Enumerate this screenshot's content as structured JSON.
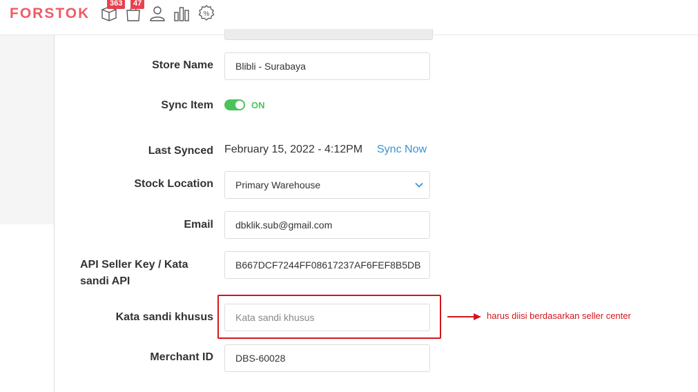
{
  "header": {
    "logo": "FORSTOK",
    "badges": {
      "packages": "363",
      "bags": "47"
    },
    "icons": [
      "package-icon",
      "bag-icon",
      "user-icon",
      "chart-bar-icon",
      "discount-icon"
    ]
  },
  "form": {
    "store_name": {
      "label": "Store Name",
      "value": "Blibli -  Surabaya"
    },
    "sync_item": {
      "label": "Sync Item",
      "state": "ON",
      "enabled": true
    },
    "last_synced": {
      "label": "Last Synced",
      "value": "February 15, 2022 - 4:12PM",
      "action": "Sync Now"
    },
    "stock_location": {
      "label": "Stock Location",
      "selected": "Primary Warehouse"
    },
    "email": {
      "label": "Email",
      "value": "dbklik.sub@gmail.com"
    },
    "api_key": {
      "label": "API Seller Key / Kata sandi API",
      "value": "B667DCF7244FF08617237AF6FEF8B5DB"
    },
    "special_password": {
      "label": "Kata sandi khusus",
      "value": "",
      "placeholder": "Kata sandi khusus"
    },
    "merchant_id": {
      "label": "Merchant ID",
      "value": "DBS-60028"
    }
  },
  "annotation": {
    "text": "harus diisi berdasarkan seller center"
  },
  "colors": {
    "brand": "#ef5b66",
    "badge": "#e8414e",
    "toggle_on": "#4cc359",
    "link": "#3a93d3",
    "annotation": "#d0161b"
  }
}
